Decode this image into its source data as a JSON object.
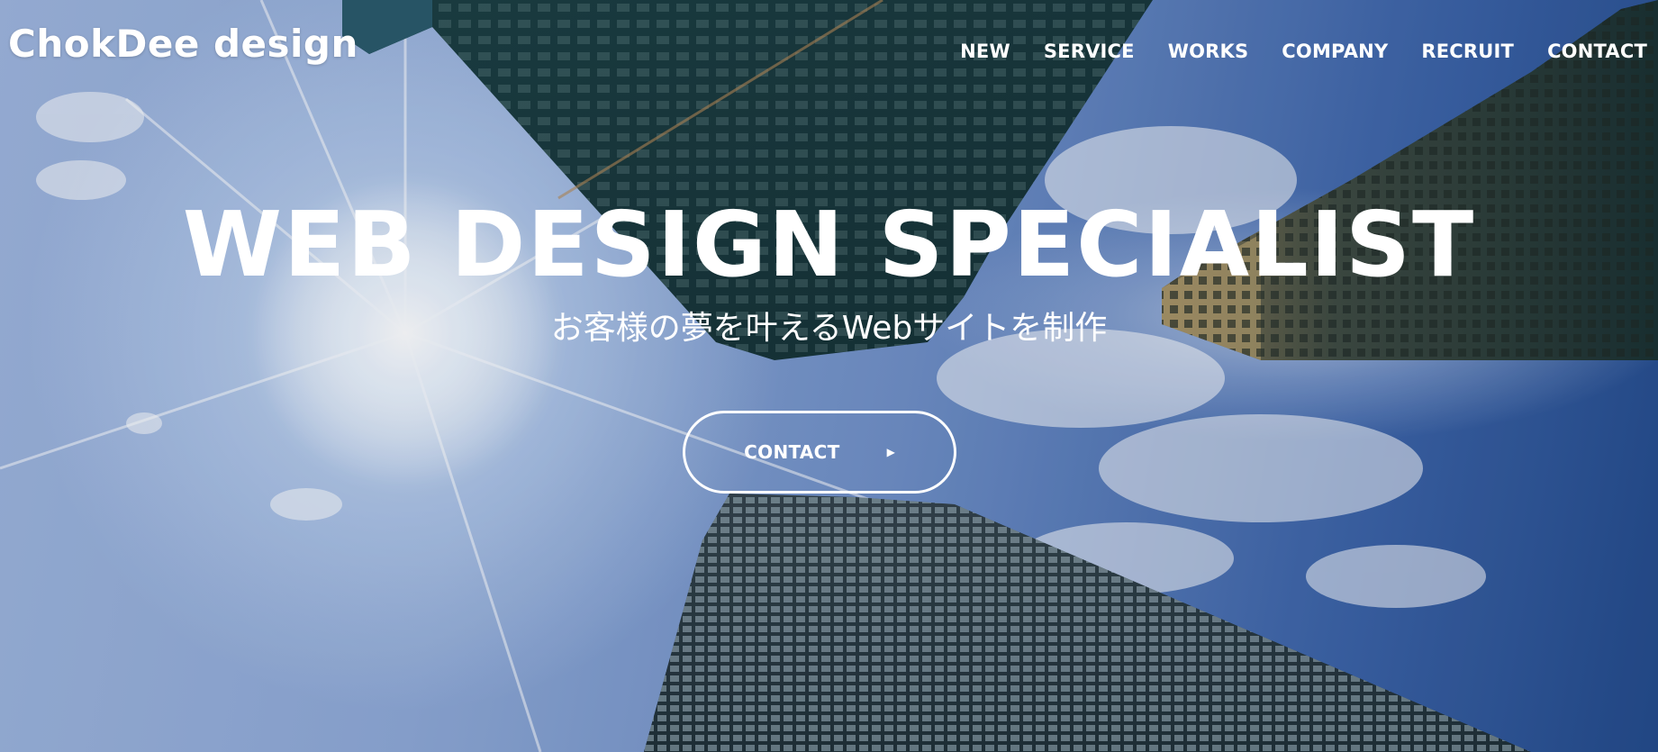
{
  "header": {
    "logo": "ChokDee design",
    "nav": [
      {
        "label": "NEW"
      },
      {
        "label": "SERVICE"
      },
      {
        "label": "WORKS"
      },
      {
        "label": "COMPANY"
      },
      {
        "label": "RECRUIT"
      },
      {
        "label": "CONTACT"
      }
    ]
  },
  "hero": {
    "title": "WEB DESIGN SPECIALIST",
    "subtitle": "お客様の夢を叶えるWebサイトを制作",
    "cta_label": "CONTACT",
    "cta_icon": "play-triangle-icon",
    "background": "skyscrapers-looking-up-sky-photo"
  },
  "colors": {
    "text": "#ffffff",
    "building_dark": "#17363a",
    "sky": "#6f8fc6"
  }
}
